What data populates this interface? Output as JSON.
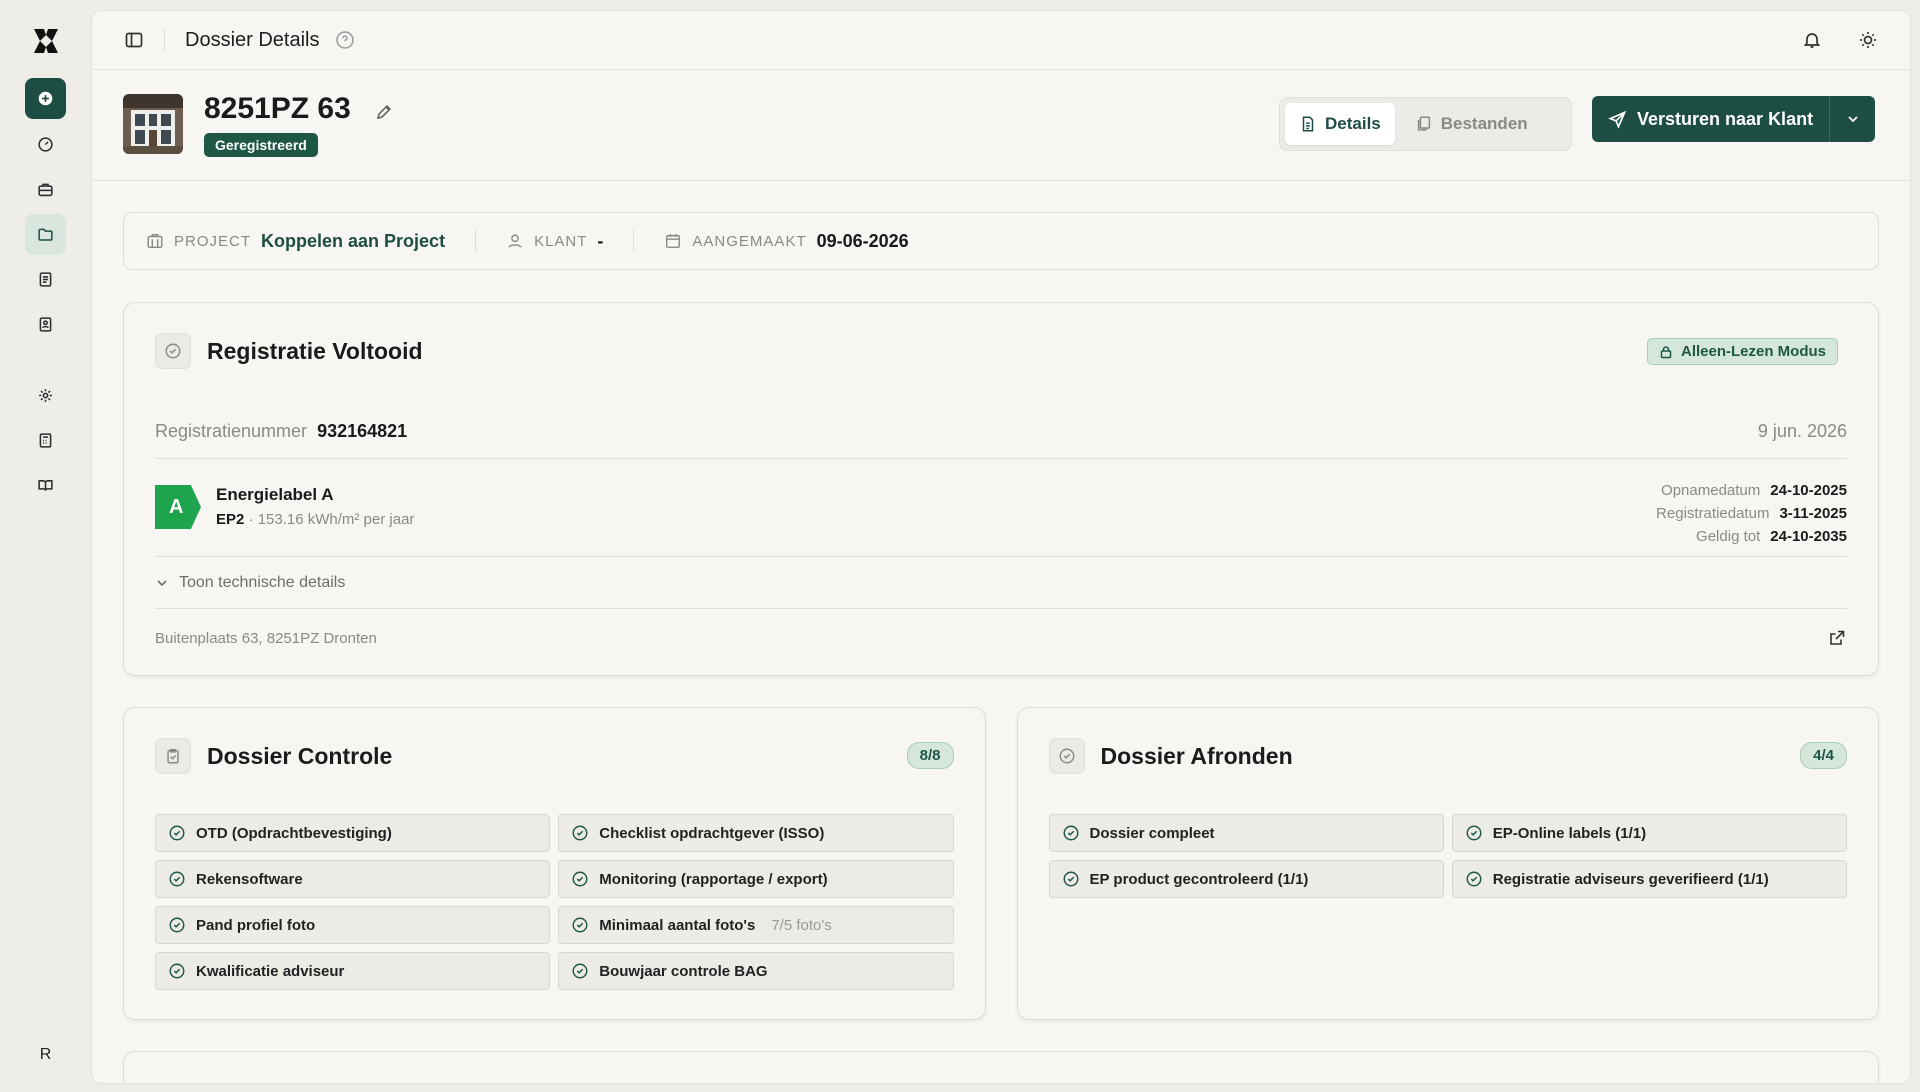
{
  "sidebar": {
    "items": [
      {
        "icon": "plus-circle-icon",
        "state": "primary"
      },
      {
        "icon": "dashboard-icon"
      },
      {
        "icon": "briefcase-icon"
      },
      {
        "icon": "folder-icon",
        "state": "active"
      },
      {
        "icon": "receipt-icon"
      },
      {
        "icon": "contacts-icon"
      },
      {
        "icon": "gear-icon"
      },
      {
        "icon": "calculator-icon"
      },
      {
        "icon": "book-icon"
      }
    ],
    "user_initial": "R"
  },
  "topbar": {
    "title": "Dossier Details"
  },
  "header": {
    "title": "8251PZ 63",
    "status": "Geregistreerd",
    "tabs": [
      {
        "label": "Details",
        "active": true
      },
      {
        "label": "Bestanden",
        "active": false
      }
    ],
    "send_label": "Versturen naar Klant"
  },
  "info": {
    "project_label": "PROJECT",
    "project_value": "Koppelen aan Project",
    "client_label": "KLANT",
    "client_value": "-",
    "created_label": "AANGEMAAKT",
    "created_value": "09-06-2026"
  },
  "registration": {
    "title": "Registratie Voltooid",
    "readonly_label": "Alleen-Lezen Modus",
    "number_label": "Registratienummer",
    "number": "932164821",
    "date": "9 jun. 2026",
    "energy_class": "A",
    "energy_title": "Energielabel A",
    "energy_ep": "EP2",
    "energy_detail": " · 153.16 kWh/m² per jaar",
    "dates": [
      {
        "label": "Opnamedatum",
        "value": "24-10-2025"
      },
      {
        "label": "Registratiedatum",
        "value": "3-11-2025"
      },
      {
        "label": "Geldig tot",
        "value": "24-10-2035"
      }
    ],
    "tech_toggle": "Toon technische details",
    "address": "Buitenplaats 63, 8251PZ Dronten"
  },
  "controle": {
    "title": "Dossier Controle",
    "count": "8/8",
    "items": [
      {
        "label": "OTD (Opdrachtbevestiging)",
        "extra": ""
      },
      {
        "label": "Checklist opdrachtgever (ISSO)",
        "extra": ""
      },
      {
        "label": "Rekensoftware",
        "extra": ""
      },
      {
        "label": "Monitoring (rapportage / export)",
        "extra": ""
      },
      {
        "label": "Pand profiel foto",
        "extra": ""
      },
      {
        "label": "Minimaal aantal foto's",
        "extra": "7/5 foto's"
      },
      {
        "label": "Kwalificatie adviseur",
        "extra": ""
      },
      {
        "label": "Bouwjaar controle BAG",
        "extra": ""
      }
    ]
  },
  "afronden": {
    "title": "Dossier Afronden",
    "count": "4/4",
    "items": [
      {
        "label": "Dossier compleet"
      },
      {
        "label": "EP-Online labels (1/1)"
      },
      {
        "label": "EP product gecontroleerd (1/1)"
      },
      {
        "label": "Registratie adviseurs geverifieerd (1/1)"
      }
    ]
  },
  "colors": {
    "brand": "#1e4d44",
    "badge_bg": "#d5e7db",
    "label_a": "#1ea44c"
  }
}
